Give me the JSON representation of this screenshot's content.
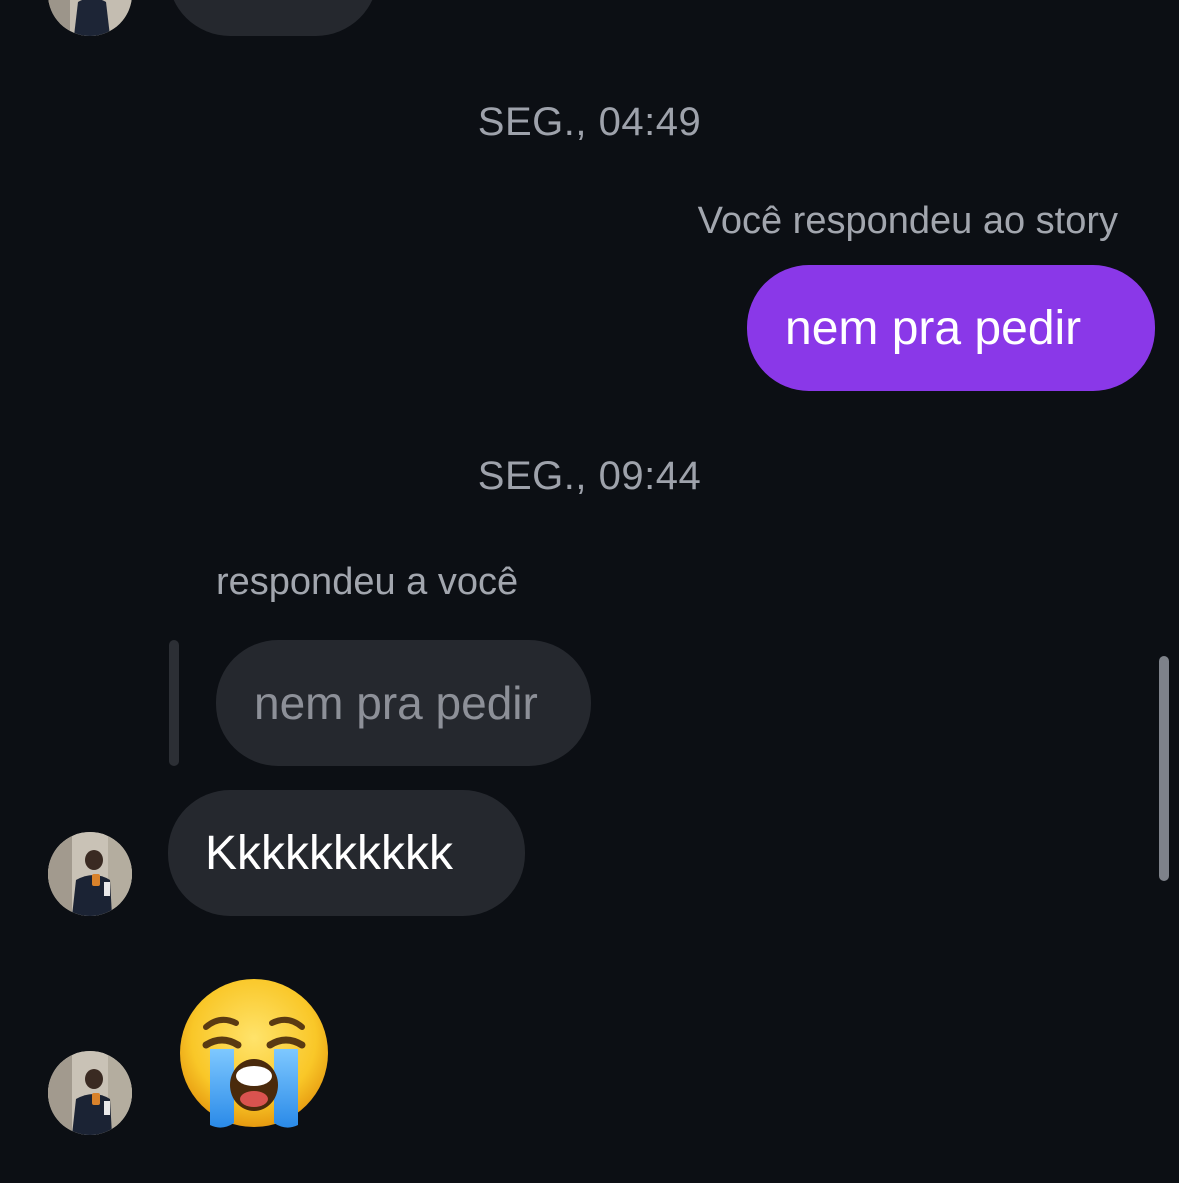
{
  "messages": {
    "timestamp_1": "SEG., 04:49",
    "story_reply_note": "Você respondeu ao story",
    "sent_text": "nem pra pedir",
    "timestamp_2": "SEG., 09:44",
    "reply_note": "respondeu a você",
    "quoted_text": "nem pra pedir",
    "received_text": "Kkkkkkkkkk",
    "emoji_name": "loudly-crying-face"
  },
  "colors": {
    "background": "#0c0f14",
    "sent_bubble": "#8a38e8",
    "received_bubble": "#25282e",
    "timestamp_text": "#9ea2ab"
  }
}
